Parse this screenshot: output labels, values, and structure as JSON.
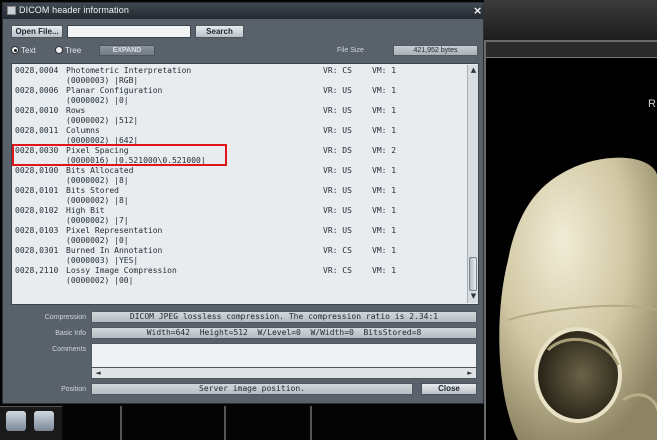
{
  "window": {
    "title": "DICOM header information",
    "close_glyph": "×"
  },
  "toolbar": {
    "open_file_label": "Open File...",
    "search_value": "",
    "search_label": "Search"
  },
  "view_mode": {
    "text_label": "Text",
    "tree_label": "Tree",
    "selected": "Text",
    "expand_label": "EXPAND"
  },
  "file_size": {
    "label": "File Size",
    "value": "421,952 bytes"
  },
  "header_rows": [
    {
      "tag": "0028,0004",
      "name": "Photometric Interpretation",
      "vr": "VR: CS",
      "vm": "VM: 1",
      "value": "(0000003) |RGB|"
    },
    {
      "tag": "0028,0006",
      "name": "Planar Configuration",
      "vr": "VR: US",
      "vm": "VM: 1",
      "value": "(0000002) |0|"
    },
    {
      "tag": "0028,0010",
      "name": "Rows",
      "vr": "VR: US",
      "vm": "VM: 1",
      "value": "(0000002) |512|"
    },
    {
      "tag": "0028,0011",
      "name": "Columns",
      "vr": "VR: US",
      "vm": "VM: 1",
      "value": "(0000002) |642|"
    },
    {
      "tag": "0028,0030",
      "name": "Pixel Spacing",
      "vr": "VR: DS",
      "vm": "VM: 2",
      "value": "(0000016) |0.521000\\0.521000|"
    },
    {
      "tag": "0028,0100",
      "name": "Bits Allocated",
      "vr": "VR: US",
      "vm": "VM: 1",
      "value": "(0000002) |8|"
    },
    {
      "tag": "0028,0101",
      "name": "Bits Stored",
      "vr": "VR: US",
      "vm": "VM: 1",
      "value": "(0000002) |8|"
    },
    {
      "tag": "0028,0102",
      "name": "High Bit",
      "vr": "VR: US",
      "vm": "VM: 1",
      "value": "(0000002) |7|"
    },
    {
      "tag": "0028,0103",
      "name": "Pixel Representation",
      "vr": "VR: US",
      "vm": "VM: 1",
      "value": "(0000002) |0|"
    },
    {
      "tag": "0028,0301",
      "name": "Burned In Annotation",
      "vr": "VR: CS",
      "vm": "VM: 1",
      "value": "(0000003) |YES|"
    },
    {
      "tag": "0028,2110",
      "name": "Lossy Image Compression",
      "vr": "VR: CS",
      "vm": "VM: 1",
      "value": "(0000002) |00|"
    }
  ],
  "highlighted_tag": "0028,0030",
  "scrollbar": {
    "up_glyph": "▲",
    "down_glyph": "▼"
  },
  "fields": {
    "compression_label": "Compression",
    "compression_value": "DICOM JPEG lossless compression. The compression ratio is 2.34:1",
    "basic_info_label": "Basic Info",
    "basic_info_value": "Width=642  Height=512  W/Level=0  W/Width=0  BitsStored=8",
    "comments_label": "Comments",
    "comments_value": "",
    "hscroll_left_glyph": "◄",
    "hscroll_right_glyph": "►",
    "position_label": "Position",
    "position_value": "Server image position.",
    "close_label": "Close"
  },
  "viewer": {
    "side_marker": "R"
  },
  "colors": {
    "highlight_border": "#e0141a",
    "dialog_bg": "#59626b",
    "list_bg": "#e9ecef"
  }
}
